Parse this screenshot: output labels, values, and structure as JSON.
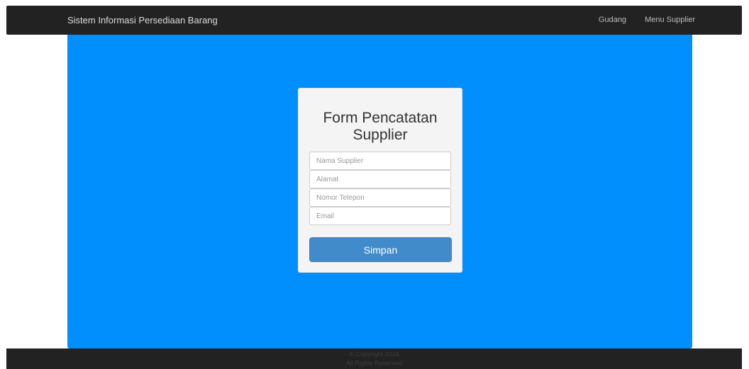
{
  "navbar": {
    "brand": "Sistem Informasi Persediaan Barang",
    "links": [
      {
        "label": "Gudang"
      },
      {
        "label": "Menu Supplier"
      }
    ]
  },
  "form": {
    "title_line1": "Form Pencatatan",
    "title_line2": "Supplier",
    "fields": [
      {
        "placeholder": "Nama Supplier",
        "value": ""
      },
      {
        "placeholder": "Alamat",
        "value": ""
      },
      {
        "placeholder": "Nomor Telepon",
        "value": ""
      },
      {
        "placeholder": "Email",
        "value": ""
      }
    ],
    "submit_label": "Simpan"
  },
  "footer": {
    "copyright": "© Copyright 2014",
    "rights": "All Rights Reserved"
  },
  "colors": {
    "navbar_bg": "#222222",
    "main_bg": "#008ffd",
    "card_bg": "#f4f4f4",
    "button_bg": "#428bca"
  }
}
